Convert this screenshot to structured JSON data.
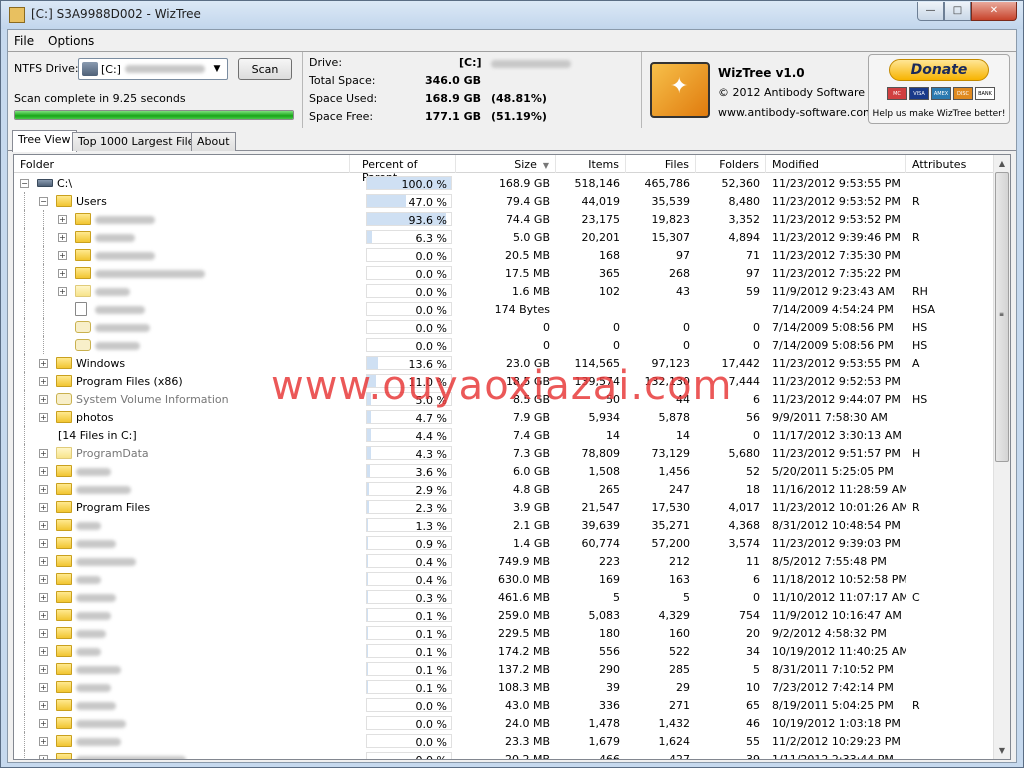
{
  "window": {
    "title": "[C:] S3A9988D002  - WizTree",
    "buttons": {
      "min": "—",
      "max": "□",
      "close": "✕"
    }
  },
  "menu": [
    {
      "label": "File"
    },
    {
      "label": "Options"
    }
  ],
  "scan": {
    "drive_label": "NTFS Drive:",
    "drive_value": "[C:]",
    "scan_button": "Scan",
    "status": "Scan complete in 9.25 seconds",
    "progress_percent": 100
  },
  "drive_info": {
    "drive_key": "Drive:",
    "drive_val": "[C:]",
    "total_key": "Total Space:",
    "total_val": "346.0 GB",
    "used_key": "Space Used:",
    "used_val": "168.9 GB",
    "used_pct": "(48.81%)",
    "free_key": "Space Free:",
    "free_val": "177.1 GB",
    "free_pct": "(51.19%)"
  },
  "about": {
    "name": "WizTree v1.0",
    "copyright": "© 2012 Antibody Software",
    "url": "www.antibody-software.com"
  },
  "donate": {
    "button": "Donate",
    "help": "Help us make WizTree better!",
    "cards": [
      "MC",
      "VISA",
      "AMEX",
      "DISC",
      "BANK"
    ]
  },
  "tabs": [
    {
      "label": "Tree View",
      "active": true
    },
    {
      "label": "Top 1000 Largest Files",
      "active": false
    },
    {
      "label": "About",
      "active": false
    }
  ],
  "columns": {
    "folder": "Folder",
    "percent": "Percent of Parent",
    "size": "Size",
    "items": "Items",
    "files": "Files",
    "folders": "Folders",
    "modified": "Modified",
    "attributes": "Attributes"
  },
  "rows": [
    {
      "name": "C:\\",
      "indent": 0,
      "icon": "drive",
      "exp": "−",
      "pct": "100.0 %",
      "fill": 100,
      "size": "168.9 GB",
      "items": "518,146",
      "files": "465,786",
      "folders": "52,360",
      "modified": "11/23/2012 9:53:55 PM",
      "attr": ""
    },
    {
      "name": "Users",
      "indent": 1,
      "icon": "folder",
      "exp": "−",
      "pct": "47.0 %",
      "fill": 47.0,
      "size": "79.4 GB",
      "items": "44,019",
      "files": "35,539",
      "folders": "8,480",
      "modified": "11/23/2012 9:53:52 PM",
      "attr": "R"
    },
    {
      "name": "",
      "blur": 60,
      "indent": 2,
      "icon": "folder",
      "exp": "+",
      "pct": "93.6 %",
      "fill": 93.6,
      "size": "74.4 GB",
      "items": "23,175",
      "files": "19,823",
      "folders": "3,352",
      "modified": "11/23/2012 9:53:52 PM",
      "attr": ""
    },
    {
      "name": "",
      "blur": 40,
      "indent": 2,
      "icon": "folder",
      "exp": "+",
      "pct": "6.3 %",
      "fill": 6.3,
      "size": "5.0 GB",
      "items": "20,201",
      "files": "15,307",
      "folders": "4,894",
      "modified": "11/23/2012 9:39:46 PM",
      "attr": "R"
    },
    {
      "name": "",
      "blur": 60,
      "indent": 2,
      "icon": "folder",
      "exp": "+",
      "pct": "0.0 %",
      "fill": 0,
      "size": "20.5 MB",
      "items": "168",
      "files": "97",
      "folders": "71",
      "modified": "11/23/2012 7:35:30 PM",
      "attr": ""
    },
    {
      "name": "",
      "blur": 110,
      "indent": 2,
      "icon": "folder",
      "exp": "+",
      "pct": "0.0 %",
      "fill": 0,
      "size": "17.5 MB",
      "items": "365",
      "files": "268",
      "folders": "97",
      "modified": "11/23/2012 7:35:22 PM",
      "attr": ""
    },
    {
      "name": "",
      "blur": 35,
      "indent": 2,
      "icon": "folderlight",
      "exp": "+",
      "pct": "0.0 %",
      "fill": 0,
      "size": "1.6 MB",
      "items": "102",
      "files": "43",
      "folders": "59",
      "modified": "11/9/2012 9:23:43 AM",
      "attr": "RH"
    },
    {
      "name": "",
      "blur": 50,
      "indent": 2,
      "icon": "file",
      "exp": "",
      "pct": "0.0 %",
      "fill": 0,
      "size": "174 Bytes",
      "items": "",
      "files": "",
      "folders": "",
      "modified": "7/14/2009 4:54:24 PM",
      "attr": "HSA"
    },
    {
      "name": "",
      "blur": 55,
      "indent": 2,
      "icon": "gear",
      "exp": "",
      "pct": "0.0 %",
      "fill": 0,
      "size": "0",
      "items": "0",
      "files": "0",
      "folders": "0",
      "modified": "7/14/2009 5:08:56 PM",
      "attr": "HS"
    },
    {
      "name": "",
      "blur": 45,
      "indent": 2,
      "icon": "gear",
      "exp": "",
      "pct": "0.0 %",
      "fill": 0,
      "size": "0",
      "items": "0",
      "files": "0",
      "folders": "0",
      "modified": "7/14/2009 5:08:56 PM",
      "attr": "HS"
    },
    {
      "name": "Windows",
      "indent": 1,
      "icon": "folder",
      "exp": "+",
      "pct": "13.6 %",
      "fill": 13.6,
      "size": "23.0 GB",
      "items": "114,565",
      "files": "97,123",
      "folders": "17,442",
      "modified": "11/23/2012 9:53:55 PM",
      "attr": "A"
    },
    {
      "name": "Program Files (x86)",
      "indent": 1,
      "icon": "folder",
      "exp": "+",
      "pct": "11.0 %",
      "fill": 11.0,
      "size": "18.5 GB",
      "items": "139,574",
      "files": "132,130",
      "folders": "7,444",
      "modified": "11/23/2012 9:52:53 PM",
      "attr": ""
    },
    {
      "name": "System Volume Information",
      "indent": 1,
      "icon": "gear",
      "exp": "+",
      "gray": true,
      "pct": "5.0 %",
      "fill": 5.0,
      "size": "8.5 GB",
      "items": "50",
      "files": "44",
      "folders": "6",
      "modified": "11/23/2012 9:44:07 PM",
      "attr": "HS"
    },
    {
      "name": "photos",
      "indent": 1,
      "icon": "folder",
      "exp": "+",
      "pct": "4.7 %",
      "fill": 4.7,
      "size": "7.9 GB",
      "items": "5,934",
      "files": "5,878",
      "folders": "56",
      "modified": "9/9/2011 7:58:30 AM",
      "attr": ""
    },
    {
      "name": "[14 Files in C:]",
      "indent": 1,
      "icon": "none",
      "exp": "",
      "pct": "4.4 %",
      "fill": 4.4,
      "size": "7.4 GB",
      "items": "14",
      "files": "14",
      "folders": "0",
      "modified": "11/17/2012 3:30:13 AM",
      "attr": ""
    },
    {
      "name": "ProgramData",
      "indent": 1,
      "icon": "folderlight",
      "exp": "+",
      "gray": true,
      "pct": "4.3 %",
      "fill": 4.3,
      "size": "7.3 GB",
      "items": "78,809",
      "files": "73,129",
      "folders": "5,680",
      "modified": "11/23/2012 9:51:57 PM",
      "attr": "H"
    },
    {
      "name": "",
      "blur": 35,
      "indent": 1,
      "icon": "folder",
      "exp": "+",
      "pct": "3.6 %",
      "fill": 3.6,
      "size": "6.0 GB",
      "items": "1,508",
      "files": "1,456",
      "folders": "52",
      "modified": "5/20/2011 5:25:05 PM",
      "attr": ""
    },
    {
      "name": "",
      "blur": 55,
      "indent": 1,
      "icon": "folder",
      "exp": "+",
      "pct": "2.9 %",
      "fill": 2.9,
      "size": "4.8 GB",
      "items": "265",
      "files": "247",
      "folders": "18",
      "modified": "11/16/2012 11:28:59 AM",
      "attr": ""
    },
    {
      "name": "Program Files",
      "indent": 1,
      "icon": "folder",
      "exp": "+",
      "pct": "2.3 %",
      "fill": 2.3,
      "size": "3.9 GB",
      "items": "21,547",
      "files": "17,530",
      "folders": "4,017",
      "modified": "11/23/2012 10:01:26 AM",
      "attr": "R"
    },
    {
      "name": "",
      "blur": 25,
      "indent": 1,
      "icon": "folder",
      "exp": "+",
      "pct": "1.3 %",
      "fill": 1.3,
      "size": "2.1 GB",
      "items": "39,639",
      "files": "35,271",
      "folders": "4,368",
      "modified": "8/31/2012 10:48:54 PM",
      "attr": ""
    },
    {
      "name": "",
      "blur": 40,
      "indent": 1,
      "icon": "folder",
      "exp": "+",
      "pct": "0.9 %",
      "fill": 0.9,
      "size": "1.4 GB",
      "items": "60,774",
      "files": "57,200",
      "folders": "3,574",
      "modified": "11/23/2012 9:39:03 PM",
      "attr": ""
    },
    {
      "name": "",
      "blur": 60,
      "indent": 1,
      "icon": "folder",
      "exp": "+",
      "pct": "0.4 %",
      "fill": 0.4,
      "size": "749.9 MB",
      "items": "223",
      "files": "212",
      "folders": "11",
      "modified": "8/5/2012 7:55:48 PM",
      "attr": ""
    },
    {
      "name": "",
      "blur": 25,
      "indent": 1,
      "icon": "folder",
      "exp": "+",
      "pct": "0.4 %",
      "fill": 0.4,
      "size": "630.0 MB",
      "items": "169",
      "files": "163",
      "folders": "6",
      "modified": "11/18/2012 10:52:58 PM",
      "attr": ""
    },
    {
      "name": "",
      "blur": 40,
      "indent": 1,
      "icon": "folder",
      "exp": "+",
      "blue": true,
      "pct": "0.3 %",
      "fill": 0.3,
      "size": "461.6 MB",
      "items": "5",
      "files": "5",
      "folders": "0",
      "modified": "11/10/2012 11:07:17 AM",
      "attr": "C"
    },
    {
      "name": "",
      "blur": 35,
      "indent": 1,
      "icon": "folder",
      "exp": "+",
      "pct": "0.1 %",
      "fill": 0.1,
      "size": "259.0 MB",
      "items": "5,083",
      "files": "4,329",
      "folders": "754",
      "modified": "11/9/2012 10:16:47 AM",
      "attr": ""
    },
    {
      "name": "",
      "blur": 30,
      "indent": 1,
      "icon": "folder",
      "exp": "+",
      "pct": "0.1 %",
      "fill": 0.1,
      "size": "229.5 MB",
      "items": "180",
      "files": "160",
      "folders": "20",
      "modified": "9/2/2012 4:58:32 PM",
      "attr": ""
    },
    {
      "name": "",
      "blur": 25,
      "indent": 1,
      "icon": "folder",
      "exp": "+",
      "pct": "0.1 %",
      "fill": 0.1,
      "size": "174.2 MB",
      "items": "556",
      "files": "522",
      "folders": "34",
      "modified": "10/19/2012 11:40:25 AM",
      "attr": ""
    },
    {
      "name": "",
      "blur": 45,
      "indent": 1,
      "icon": "folder",
      "exp": "+",
      "pct": "0.1 %",
      "fill": 0.1,
      "size": "137.2 MB",
      "items": "290",
      "files": "285",
      "folders": "5",
      "modified": "8/31/2011 7:10:52 PM",
      "attr": ""
    },
    {
      "name": "",
      "blur": 35,
      "indent": 1,
      "icon": "folder",
      "exp": "+",
      "pct": "0.1 %",
      "fill": 0.1,
      "size": "108.3 MB",
      "items": "39",
      "files": "29",
      "folders": "10",
      "modified": "7/23/2012 7:42:14 PM",
      "attr": ""
    },
    {
      "name": "",
      "blur": 40,
      "indent": 1,
      "icon": "folder",
      "exp": "+",
      "pct": "0.0 %",
      "fill": 0,
      "size": "43.0 MB",
      "items": "336",
      "files": "271",
      "folders": "65",
      "modified": "8/19/2011 5:04:25 PM",
      "attr": "R"
    },
    {
      "name": "",
      "blur": 50,
      "indent": 1,
      "icon": "folder",
      "exp": "+",
      "pct": "0.0 %",
      "fill": 0,
      "size": "24.0 MB",
      "items": "1,478",
      "files": "1,432",
      "folders": "46",
      "modified": "10/19/2012 1:03:18 PM",
      "attr": ""
    },
    {
      "name": "",
      "blur": 45,
      "indent": 1,
      "icon": "folder",
      "exp": "+",
      "pct": "0.0 %",
      "fill": 0,
      "size": "23.3 MB",
      "items": "1,679",
      "files": "1,624",
      "folders": "55",
      "modified": "11/2/2012 10:29:23 PM",
      "attr": ""
    },
    {
      "name": "",
      "blur": 110,
      "indent": 1,
      "icon": "folder",
      "exp": "+",
      "pct": "0.0 %",
      "fill": 0,
      "size": "20.2 MB",
      "items": "466",
      "files": "427",
      "folders": "39",
      "modified": "1/11/2012 2:33:44 PM",
      "attr": ""
    }
  ],
  "watermark": "www.ouyaoxiazai.com"
}
